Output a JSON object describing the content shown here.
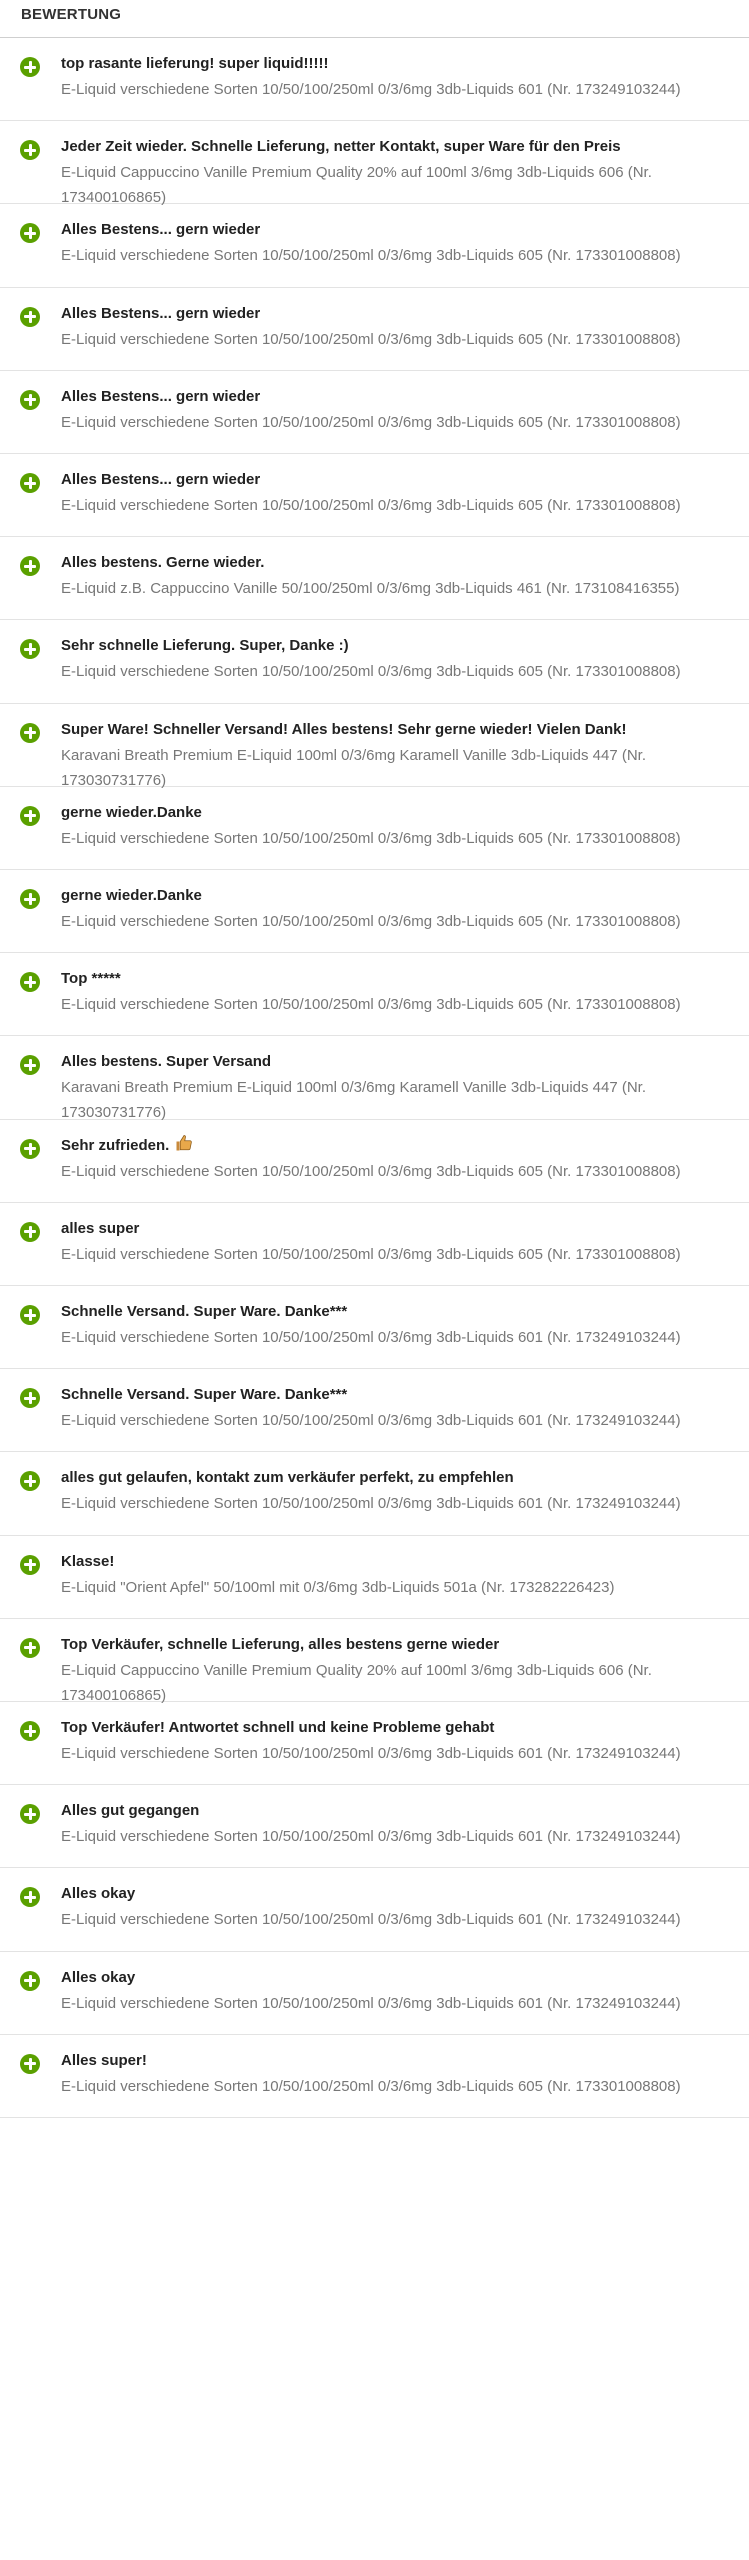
{
  "header": {
    "title": "BEWERTUNG"
  },
  "reviews": [
    {
      "comment": "top rasante lieferung! super liquid!!!!!",
      "item": "E-Liquid verschiedene Sorten 10/50/100/250ml 0/3/6mg 3db-Liquids 601 (Nr. 173249103244)",
      "rating": "positive"
    },
    {
      "comment": "Jeder Zeit wieder. Schnelle Lieferung, netter Kontakt, super Ware für den Preis",
      "item": "E-Liquid Cappuccino Vanille Premium Quality 20% auf 100ml 3/6mg 3db-Liquids 606 (Nr. 173400106865)",
      "rating": "positive"
    },
    {
      "comment": "Alles Bestens... gern wieder",
      "item": "E-Liquid verschiedene Sorten 10/50/100/250ml 0/3/6mg 3db-Liquids 605 (Nr. 173301008808)",
      "rating": "positive"
    },
    {
      "comment": "Alles Bestens... gern wieder",
      "item": "E-Liquid verschiedene Sorten 10/50/100/250ml 0/3/6mg 3db-Liquids 605 (Nr. 173301008808)",
      "rating": "positive"
    },
    {
      "comment": "Alles Bestens... gern wieder",
      "item": "E-Liquid verschiedene Sorten 10/50/100/250ml 0/3/6mg 3db-Liquids 605 (Nr. 173301008808)",
      "rating": "positive"
    },
    {
      "comment": "Alles Bestens... gern wieder",
      "item": "E-Liquid verschiedene Sorten 10/50/100/250ml 0/3/6mg 3db-Liquids 605 (Nr. 173301008808)",
      "rating": "positive"
    },
    {
      "comment": "Alles bestens. Gerne wieder.",
      "item": "E-Liquid z.B. Cappuccino Vanille 50/100/250ml 0/3/6mg 3db-Liquids 461 (Nr. 173108416355)",
      "rating": "positive"
    },
    {
      "comment": "Sehr schnelle Lieferung. Super, Danke :)",
      "item": "E-Liquid verschiedene Sorten 10/50/100/250ml 0/3/6mg 3db-Liquids 605 (Nr. 173301008808)",
      "rating": "positive"
    },
    {
      "comment": "Super Ware! Schneller Versand! Alles bestens! Sehr gerne wieder! Vielen Dank!",
      "item": "Karavani Breath Premium E-Liquid 100ml 0/3/6mg Karamell Vanille 3db-Liquids 447 (Nr. 173030731776)",
      "rating": "positive"
    },
    {
      "comment": "gerne wieder.Danke",
      "item": "E-Liquid verschiedene Sorten 10/50/100/250ml 0/3/6mg 3db-Liquids 605 (Nr. 173301008808)",
      "rating": "positive"
    },
    {
      "comment": "gerne wieder.Danke",
      "item": "E-Liquid verschiedene Sorten 10/50/100/250ml 0/3/6mg 3db-Liquids 605 (Nr. 173301008808)",
      "rating": "positive"
    },
    {
      "comment": "Top *****",
      "item": "E-Liquid verschiedene Sorten 10/50/100/250ml 0/3/6mg 3db-Liquids 605 (Nr. 173301008808)",
      "rating": "positive"
    },
    {
      "comment": "Alles bestens. Super Versand",
      "item": "Karavani Breath Premium E-Liquid 100ml 0/3/6mg Karamell Vanille 3db-Liquids 447 (Nr. 173030731776)",
      "rating": "positive"
    },
    {
      "comment": "Sehr zufrieden.",
      "item": "E-Liquid verschiedene Sorten 10/50/100/250ml 0/3/6mg 3db-Liquids 605 (Nr. 173301008808)",
      "rating": "positive",
      "emoji": "thumbs-up-emoji"
    },
    {
      "comment": "alles super",
      "item": "E-Liquid verschiedene Sorten 10/50/100/250ml 0/3/6mg 3db-Liquids 605 (Nr. 173301008808)",
      "rating": "positive"
    },
    {
      "comment": "Schnelle Versand. Super Ware. Danke***",
      "item": "E-Liquid verschiedene Sorten 10/50/100/250ml 0/3/6mg 3db-Liquids 601 (Nr. 173249103244)",
      "rating": "positive"
    },
    {
      "comment": "Schnelle Versand. Super Ware. Danke***",
      "item": "E-Liquid verschiedene Sorten 10/50/100/250ml 0/3/6mg 3db-Liquids 601 (Nr. 173249103244)",
      "rating": "positive"
    },
    {
      "comment": "alles gut gelaufen, kontakt zum verkäufer perfekt, zu empfehlen",
      "item": "E-Liquid verschiedene Sorten 10/50/100/250ml 0/3/6mg 3db-Liquids 601 (Nr. 173249103244)",
      "rating": "positive"
    },
    {
      "comment": "Klasse!",
      "item": "E-Liquid \"Orient Apfel\" 50/100ml mit 0/3/6mg 3db-Liquids 501a (Nr. 173282226423)",
      "rating": "positive"
    },
    {
      "comment": "Top Verkäufer, schnelle Lieferung, alles bestens gerne wieder",
      "item": "E-Liquid Cappuccino Vanille Premium Quality 20% auf 100ml 3/6mg 3db-Liquids 606 (Nr. 173400106865)",
      "rating": "positive"
    },
    {
      "comment": "Top Verkäufer! Antwortet schnell und keine Probleme gehabt",
      "item": "E-Liquid verschiedene Sorten 10/50/100/250ml 0/3/6mg 3db-Liquids 601 (Nr. 173249103244)",
      "rating": "positive"
    },
    {
      "comment": "Alles gut gegangen",
      "item": "E-Liquid verschiedene Sorten 10/50/100/250ml 0/3/6mg 3db-Liquids 601 (Nr. 173249103244)",
      "rating": "positive"
    },
    {
      "comment": "Alles okay",
      "item": "E-Liquid verschiedene Sorten 10/50/100/250ml 0/3/6mg 3db-Liquids 601 (Nr. 173249103244)",
      "rating": "positive"
    },
    {
      "comment": "Alles okay",
      "item": "E-Liquid verschiedene Sorten 10/50/100/250ml 0/3/6mg 3db-Liquids 601 (Nr. 173249103244)",
      "rating": "positive"
    },
    {
      "comment": "Alles super!",
      "item": "E-Liquid verschiedene Sorten 10/50/100/250ml 0/3/6mg 3db-Liquids 605 (Nr. 173301008808)",
      "rating": "positive"
    }
  ],
  "colors": {
    "positive_icon": "#5aa000",
    "comment_text": "#222222",
    "item_text": "#777777",
    "divider": "#e3e3e3"
  }
}
